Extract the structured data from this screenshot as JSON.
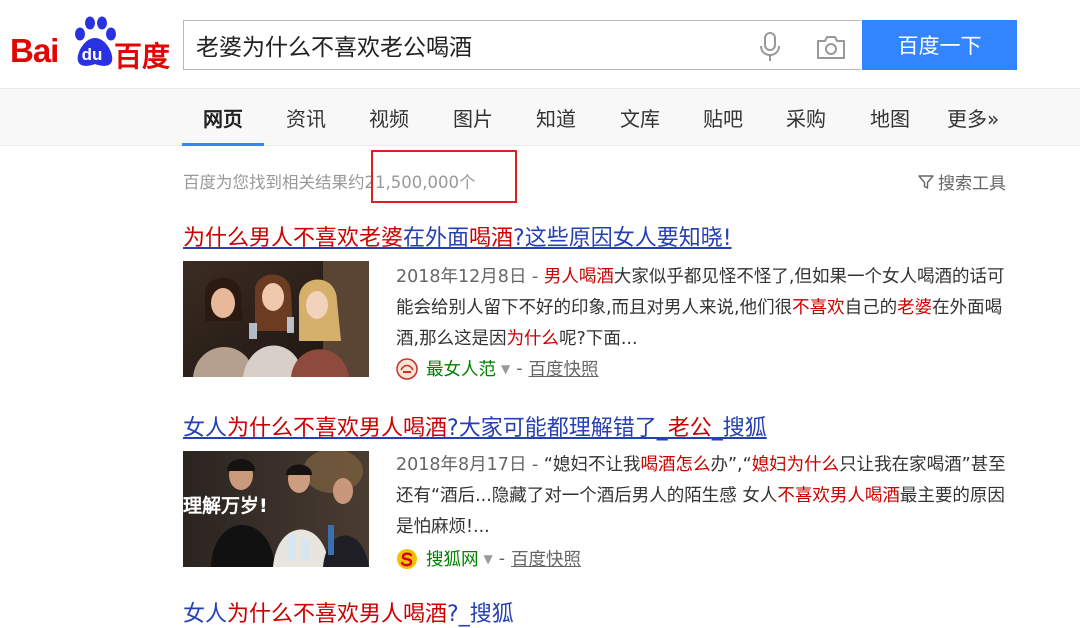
{
  "logo": {
    "text_latin": "Bai",
    "text_du": "du",
    "text_cn": "百度"
  },
  "search": {
    "query": "老婆为什么不喜欢老公喝酒",
    "button_label": "百度一下"
  },
  "tabs": [
    "网页",
    "资讯",
    "视频",
    "图片",
    "知道",
    "文库",
    "贴吧",
    "采购",
    "地图",
    "更多»"
  ],
  "active_tab": "网页",
  "result_count": {
    "prefix": "百度为您找到相关结果约",
    "number": "21,500,000",
    "suffix": "个"
  },
  "search_tools_label": "搜索工具",
  "results": [
    {
      "title_parts": [
        {
          "text": "为什么男人不喜欢老婆",
          "hl": true
        },
        {
          "text": "在外面",
          "hl": false
        },
        {
          "text": "喝酒",
          "hl": true
        },
        {
          "text": "?这些原因女人要知晓!",
          "hl": false
        }
      ],
      "date": "2018年12月8日",
      "snippet_parts": [
        {
          "text": "男人喝酒",
          "hl": true
        },
        {
          "text": "大家似乎都见怪不怪了,但如果一个女人喝酒的话可能会给别人留下不好的印象,而且对男人来说,他们很",
          "hl": false
        },
        {
          "text": "不喜欢",
          "hl": true
        },
        {
          "text": "自己的",
          "hl": false
        },
        {
          "text": "老婆",
          "hl": true
        },
        {
          "text": "在外面喝酒,那么这是因",
          "hl": false
        },
        {
          "text": "为什么",
          "hl": true
        },
        {
          "text": "呢?下面...",
          "hl": false
        }
      ],
      "site_name": "最女人范",
      "cache_label": "百度快照"
    },
    {
      "title_parts": [
        {
          "text": "女人",
          "hl": false
        },
        {
          "text": "为什么不喜欢男人喝酒",
          "hl": true
        },
        {
          "text": "?大家可能都理解错了_",
          "hl": false
        },
        {
          "text": "老公",
          "hl": true
        },
        {
          "text": "_搜狐",
          "hl": false
        }
      ],
      "date": "2018年8月17日",
      "snippet_parts": [
        {
          "text": "“媳妇不让我",
          "hl": false
        },
        {
          "text": "喝酒怎么",
          "hl": true
        },
        {
          "text": "办”,“",
          "hl": false
        },
        {
          "text": "媳妇为什么",
          "hl": true
        },
        {
          "text": "只让我在家喝酒”甚至还有“酒后...隐藏了对一个酒后男人的陌生感 女人",
          "hl": false
        },
        {
          "text": "不喜欢男人喝酒",
          "hl": true
        },
        {
          "text": "最主要的原因是怕麻烦!...",
          "hl": false
        }
      ],
      "thumb_caption": "理解万岁!",
      "site_name": "搜狐网",
      "cache_label": "百度快照"
    }
  ],
  "partial_result": {
    "title_parts": [
      {
        "text": "女人",
        "hl": false
      },
      {
        "text": "为什么不喜欢男人喝酒",
        "hl": true
      },
      {
        "text": "?_搜狐",
        "hl": false
      }
    ]
  },
  "colors": {
    "brand_red": "#e10602",
    "brand_blue": "#3385ff",
    "link": "#2440b3",
    "highlight": "#cc0000",
    "site_green": "#008000",
    "annotation_red": "#e02020"
  }
}
